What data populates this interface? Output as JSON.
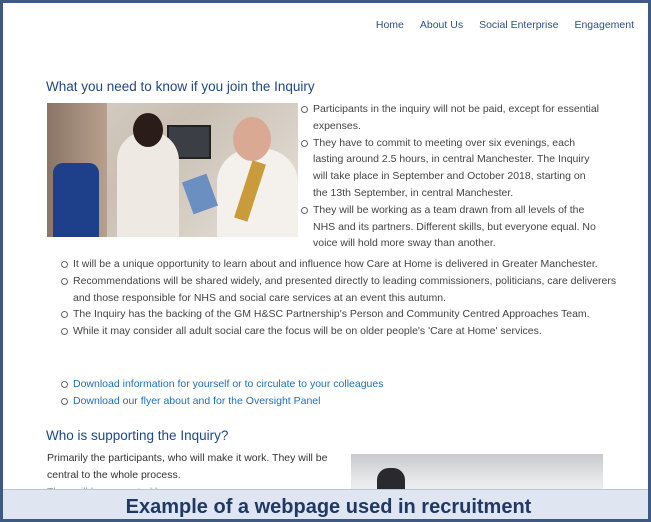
{
  "nav": {
    "items": [
      "Home",
      "About Us",
      "Social Enterprise",
      "Engagement"
    ]
  },
  "section1": {
    "heading": "What you need to know if you join the Inquiry",
    "photo_bullets": [
      "Participants in the inquiry will not be paid, except for essential expenses.",
      "They have to commit to meeting over six evenings, each lasting around 2.5 hours, in central Manchester. The Inquiry will take place in September and October 2018, starting on the 13th September, in central Manchester.",
      "They will be working as a team drawn from all levels of the NHS and its partners. Different skills, but everyone equal.  No voice will hold more sway than another."
    ],
    "bullets": [
      "It will be a unique opportunity to learn about and influence how Care at Home is delivered in Greater Manchester.",
      "Recommendations will be shared widely, and presented directly to leading commissioners, politicians, care deliverers and those responsible for NHS and social care services at an event this autumn.",
      "The Inquiry has the backing of the GM H&SC Partnership's Person and Community Centred Approaches Team.",
      "While it may consider all adult social care the focus will be on older people's 'Care at Home' services."
    ],
    "links": [
      "Download information for yourself or to circulate to your colleagues",
      "Download our flyer about and for the Oversight Panel"
    ]
  },
  "section2": {
    "heading": "Who is supporting the Inquiry?",
    "text": "Primarily the participants, who will make it work. They will be central to the whole process.",
    "faded": "They will be supported by"
  },
  "caption": "Example of a webpage used in recruitment"
}
